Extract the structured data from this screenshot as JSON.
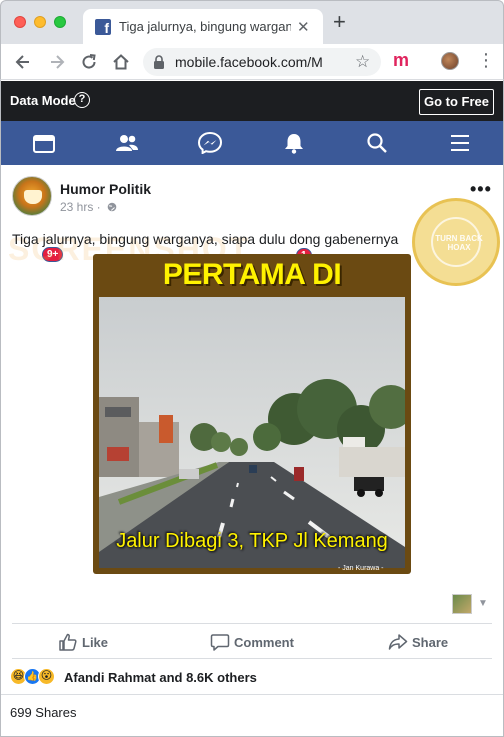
{
  "browser": {
    "tab_title": "Tiga jalurnya, bingung warganya, si",
    "tab_close": "✕",
    "new_tab": "+",
    "url": "mobile.facebook.com/M...",
    "extension_label": "m",
    "menu_glyph": "⋮",
    "star_glyph": "☆"
  },
  "data_mode": {
    "label": "Data Mode",
    "help_glyph": "?",
    "go_free_label": "Go to Free"
  },
  "fb_nav": {
    "home_badge": "9+",
    "notifications_badge": "1",
    "accent_color": "#3b5998"
  },
  "post": {
    "author": "Humor Politik",
    "meta": "23 hrs ·",
    "more_glyph": "•••",
    "caption": "Tiga jalurnya, bingung warganya, siapa dulu dong gabenernya",
    "image": {
      "title": "PERTAMA DI INDONESIA",
      "subtitle": "Jalur Dibagi 3, TKP Jl Kemang",
      "credit": "- Jan Kurawa -"
    },
    "watermark": {
      "text": "SCREENSHOT",
      "seal_text": "TURN BACK HOAX",
      "seal_ring_text": "MASYARAKAT ANTI FITNAH INDONESIA · MAFINDO"
    }
  },
  "actions": {
    "like": "Like",
    "comment": "Comment",
    "share": "Share"
  },
  "reactions": {
    "summary": "Afandi Rahmat and 8.6K others",
    "icons": [
      "haha-icon",
      "like-icon",
      "wow-icon"
    ]
  },
  "shares": {
    "label": "699 Shares"
  }
}
